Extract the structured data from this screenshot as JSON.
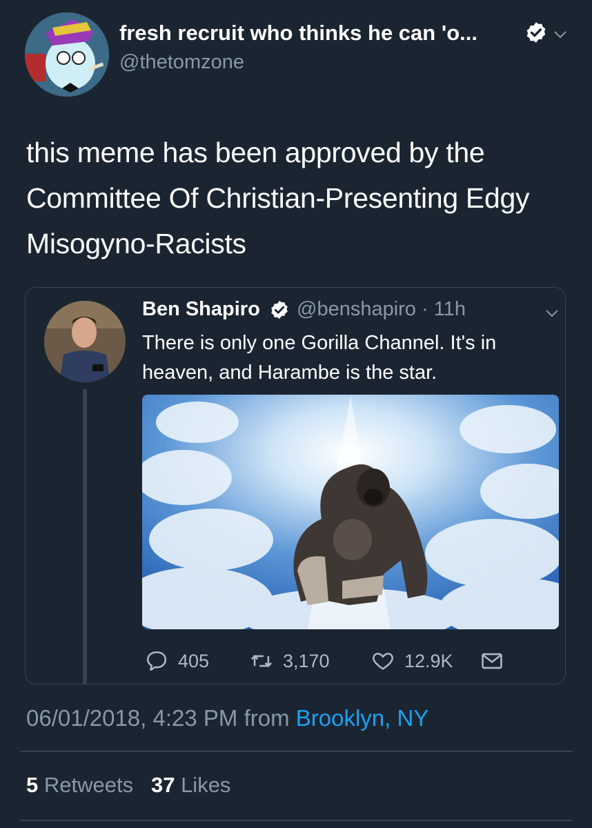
{
  "author": {
    "display_name": "fresh recruit who thinks he can 'o...",
    "handle": "@thetomzone"
  },
  "tweet": {
    "text": "this meme has been approved by the Committee Of Christian-Presenting Edgy Misogyno-Racists",
    "timestamp": "06/01/2018, 4:23 PM",
    "from_label": "from",
    "location": "Brooklyn, NY"
  },
  "quoted": {
    "name": "Ben Shapiro",
    "handle_time": "@benshapiro · 11h",
    "text": "There is only one Gorilla Channel. It's in heaven, and Harambe is the star.",
    "replies": "405",
    "retweets": "3,170",
    "likes": "12.9K"
  },
  "stats": {
    "retweets_count": "5",
    "retweets_label": "Retweets",
    "likes_count": "37",
    "likes_label": "Likes"
  },
  "icons": {
    "verified": "verified-badge-icon",
    "chevron": "chevron-down-icon",
    "reply": "reply-icon",
    "retweet": "retweet-icon",
    "like": "heart-icon",
    "dm": "envelope-icon"
  },
  "colors": {
    "background": "#1b2532",
    "link": "#1da1f2",
    "muted": "#8899a6",
    "border": "#38444d"
  }
}
